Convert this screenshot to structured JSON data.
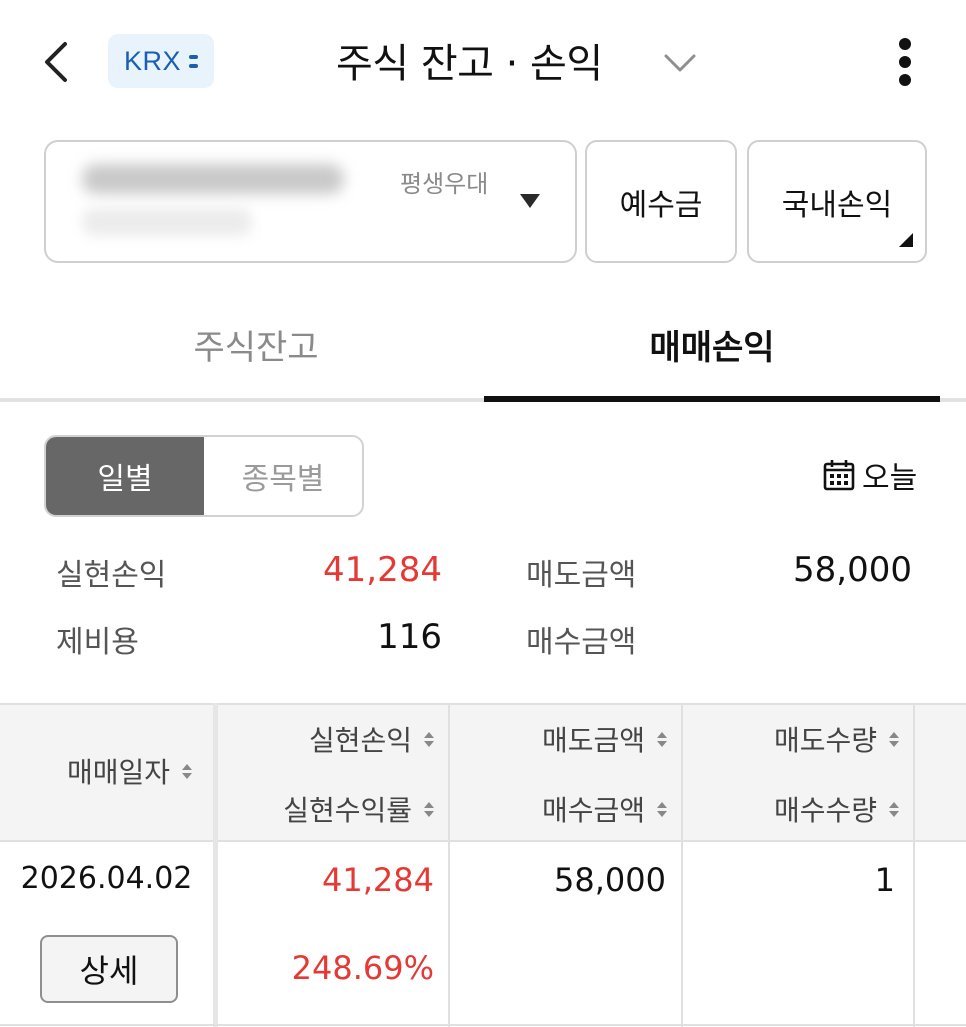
{
  "header": {
    "exchange_badge": "KRX",
    "title": "주식 잔고 · 손익"
  },
  "account": {
    "type_label": "평생우대"
  },
  "buttons": {
    "deposit": "예수금",
    "domestic_pnl": "국내손익"
  },
  "tabs": [
    {
      "label": "주식잔고",
      "active": false
    },
    {
      "label": "매매손익",
      "active": true
    }
  ],
  "segment": {
    "daily": "일별",
    "by_stock": "종목별"
  },
  "date_filter": {
    "label": "오늘"
  },
  "summary": {
    "realized_pnl_label": "실현손익",
    "realized_pnl_value": "41,284",
    "fees_label": "제비용",
    "fees_value": "116",
    "sell_amount_label": "매도금액",
    "sell_amount_value": "58,000",
    "buy_amount_label": "매수금액"
  },
  "table": {
    "headers": {
      "trade_date": "매매일자",
      "realized_pnl": "실현손익",
      "realized_return": "실현수익률",
      "sell_amount": "매도금액",
      "buy_amount": "매수금액",
      "sell_qty": "매도수량",
      "buy_qty": "매수수량"
    },
    "rows": [
      {
        "trade_date": "2026.04.02",
        "detail_label": "상세",
        "realized_pnl": "41,284",
        "realized_return": "248.69%",
        "sell_amount": "58,000",
        "sell_qty": "1"
      }
    ]
  },
  "colors": {
    "profit": "#e53935",
    "badge_bg": "#e9f3fc",
    "badge_text": "#1a5fb4",
    "segment_active": "#676767"
  }
}
